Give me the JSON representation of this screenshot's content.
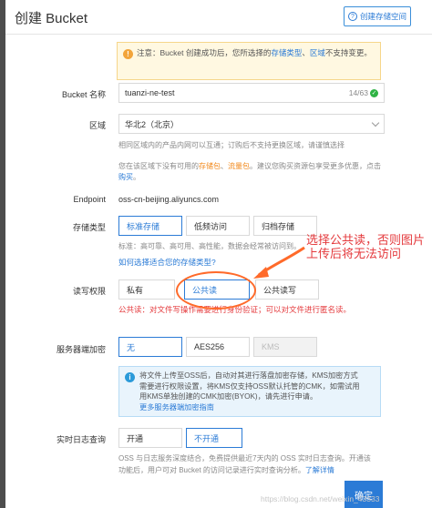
{
  "dialog": {
    "title": "创建 Bucket",
    "help_button": "创建存储空间"
  },
  "notice": {
    "prefix": "注意：Bucket 创建成功后，您所选择的",
    "hl1": "存储类型",
    "sep": "、",
    "hl2": "区域",
    "suffix": "不支持变更。"
  },
  "bucket_name": {
    "label": "Bucket 名称",
    "value": "tuanzi-ne-test",
    "counter": "14/63"
  },
  "region": {
    "label": "区域",
    "value": "华北2（北京）",
    "hint1": "相同区域内的产品内网可以互通；订购后不支持更换区域，请谨慎选择",
    "hint2_prefix": "您在该区域下没有可用的",
    "hint2_hl1": "存储包",
    "hint2_sep": "、",
    "hint2_hl2": "流量包",
    "hint2_mid": "。建议您购买资源包享受更多优惠，点击",
    "hint2_link": "购买",
    "hint2_end": "。"
  },
  "endpoint": {
    "label": "Endpoint",
    "value": "oss-cn-beijing.aliyuncs.com"
  },
  "storage_class": {
    "label": "存储类型",
    "options": [
      "标准存储",
      "低频访问",
      "归档存储"
    ],
    "hint": "标准：高可靠、高可用、高性能，数据会经常被访问到。",
    "link": "如何选择适合您的存储类型?"
  },
  "acl": {
    "label": "读写权限",
    "options": [
      "私有",
      "公共读",
      "公共读写"
    ],
    "warning": "公共读：对文件写操作需要进行身份验证；可以对文件进行匿名读。"
  },
  "encryption": {
    "label": "服务器端加密",
    "options": [
      "无",
      "AES256",
      "KMS"
    ],
    "info1": "将文件上传至OSS后，自动对其进行落盘加密存储，KMS加密方式",
    "info2": "需要进行权限设置，将KMS仅支持OSS默认托管的CMK，如需试用",
    "info3": "用KMS单独创建的CMK加密(BYOK)，请先进行申请。",
    "info_link": "更多服务器端加密指南"
  },
  "realtime_log": {
    "label": "实时日志查询",
    "options": [
      "开通",
      "不开通"
    ],
    "hint1": "OSS 与日志服务深度结合，免费提供最近7天内的 OSS 实时日志查询。开通该",
    "hint2": "功能后，用户可对 Bucket 的访问记录进行实时查询分析。",
    "hint2_link": "了解详情"
  },
  "confirm_button": "确定",
  "annotation": {
    "line1": "选择公共读，否则图片",
    "line2": "上传后将无法访问"
  },
  "watermark": "https://blog.csdn.net/weixin_43333"
}
